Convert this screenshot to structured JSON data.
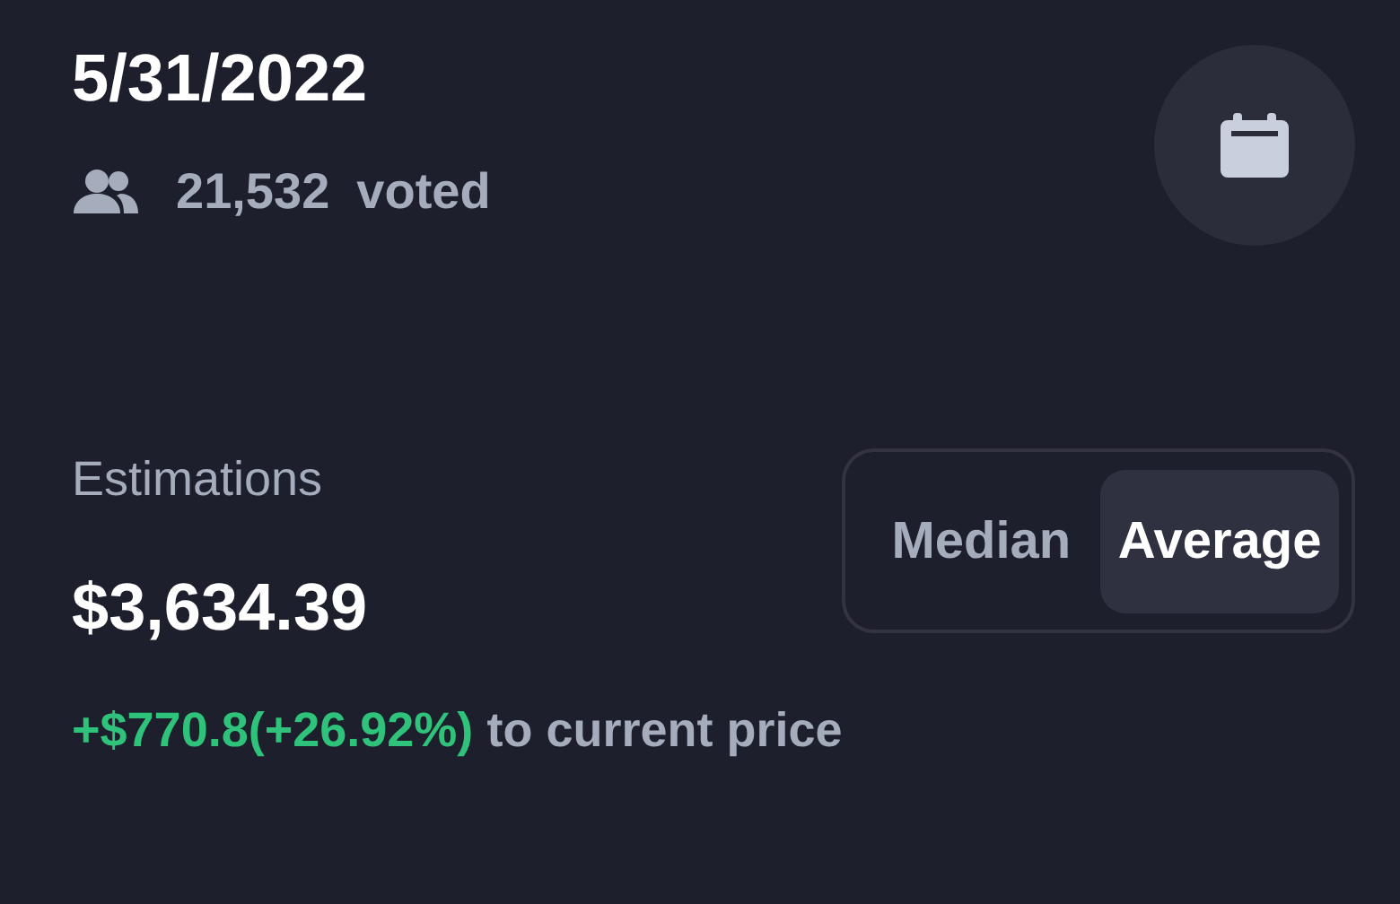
{
  "date": "5/31/2022",
  "votes": {
    "count": "21,532",
    "label": "voted"
  },
  "estimations": {
    "label": "Estimations",
    "value": "$3,634.39",
    "change": "+$770.8(+26.92%)",
    "change_suffix": "to current price"
  },
  "modes": [
    {
      "label": "Median",
      "selected": false
    },
    {
      "label": "Average",
      "selected": true
    }
  ]
}
